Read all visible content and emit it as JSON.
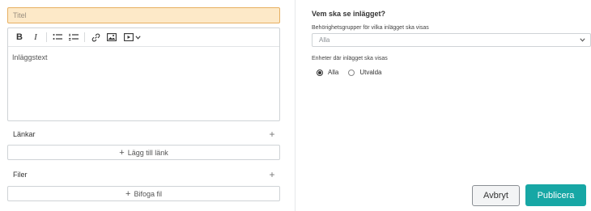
{
  "form": {
    "title_placeholder": "Titel",
    "editor_placeholder": "Inläggstext"
  },
  "toolbar": {
    "items": [
      "bold-icon",
      "italic-icon",
      "bullet-list-icon",
      "numbered-list-icon",
      "link-icon",
      "image-icon",
      "video-icon",
      "chevron-down-icon"
    ],
    "bold_glyph": "B",
    "italic_glyph": "I"
  },
  "links": {
    "label": "Länkar",
    "add_label": "Lägg till länk"
  },
  "files": {
    "label": "Filer",
    "add_label": "Bifoga fil"
  },
  "audience": {
    "heading": "Vem ska se inlägget?",
    "groups_label": "Behörighetsgrupper för vilka inlägget ska visas",
    "groups_value": "Alla",
    "units_label": "Enheter där inlägget ska visas",
    "options": [
      "Alla",
      "Utvalda"
    ],
    "selected": "Alla"
  },
  "actions": {
    "cancel_label": "Avbryt",
    "publish_label": "Publicera"
  },
  "colors": {
    "title_bg": "#fde9c8",
    "title_border": "#e7b062",
    "accent": "#17a7a5"
  }
}
